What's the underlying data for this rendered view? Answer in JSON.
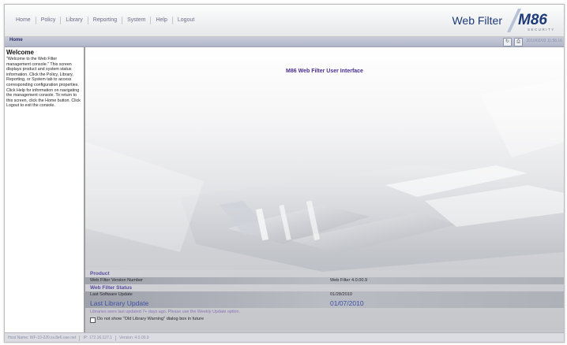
{
  "menu": {
    "items": [
      "Home",
      "Policy",
      "Library",
      "Reporting",
      "System",
      "Help",
      "Logout"
    ]
  },
  "header": {
    "product": "Web Filter",
    "logo_text": "M86",
    "logo_sub": "SECURITY"
  },
  "breadcrumb": {
    "current": "Home"
  },
  "toolbar": {
    "datetime": "2010/02/02 11:56:16"
  },
  "help_panel": {
    "title": "Welcome",
    "text": "\"Welcome to the Web Filter management console.\" This screen displays product and system status information. Click the Policy, Library, Reporting, or System tab to access corresponding configuration properties. Click Help for information on navigating the management console. To return to this screen, click the Home button. Click Logout to exit the console."
  },
  "main": {
    "title": "M86 Web Filter User Interface"
  },
  "status": {
    "product_header": "Product",
    "version_label": "Web Filter Version Number",
    "version_value": "Web Filter 4.0.00.9",
    "wf_status_header": "Web Filter Status",
    "last_software_label": "Last Software Update",
    "last_software_value": "01/28/2010",
    "last_library_label": "Last Library Update",
    "last_library_value": "01/07/2010",
    "warning": "Libraries were last updated 7+ days ago. Please use the Weekly Update option.",
    "checkbox_label": "Do not show \"Old Library Warning\" dialog box in future"
  },
  "footer": {
    "host": "Host Name: WF-10-220.sv.8e6.ose.net",
    "ip": "IP: 172.16.137.1",
    "version": "Version: 4.0.00.9"
  },
  "colors": {
    "brand_blue": "#1e3a78",
    "accent_purple": "#4a2e8e",
    "link_blue": "#3d4fa6"
  }
}
